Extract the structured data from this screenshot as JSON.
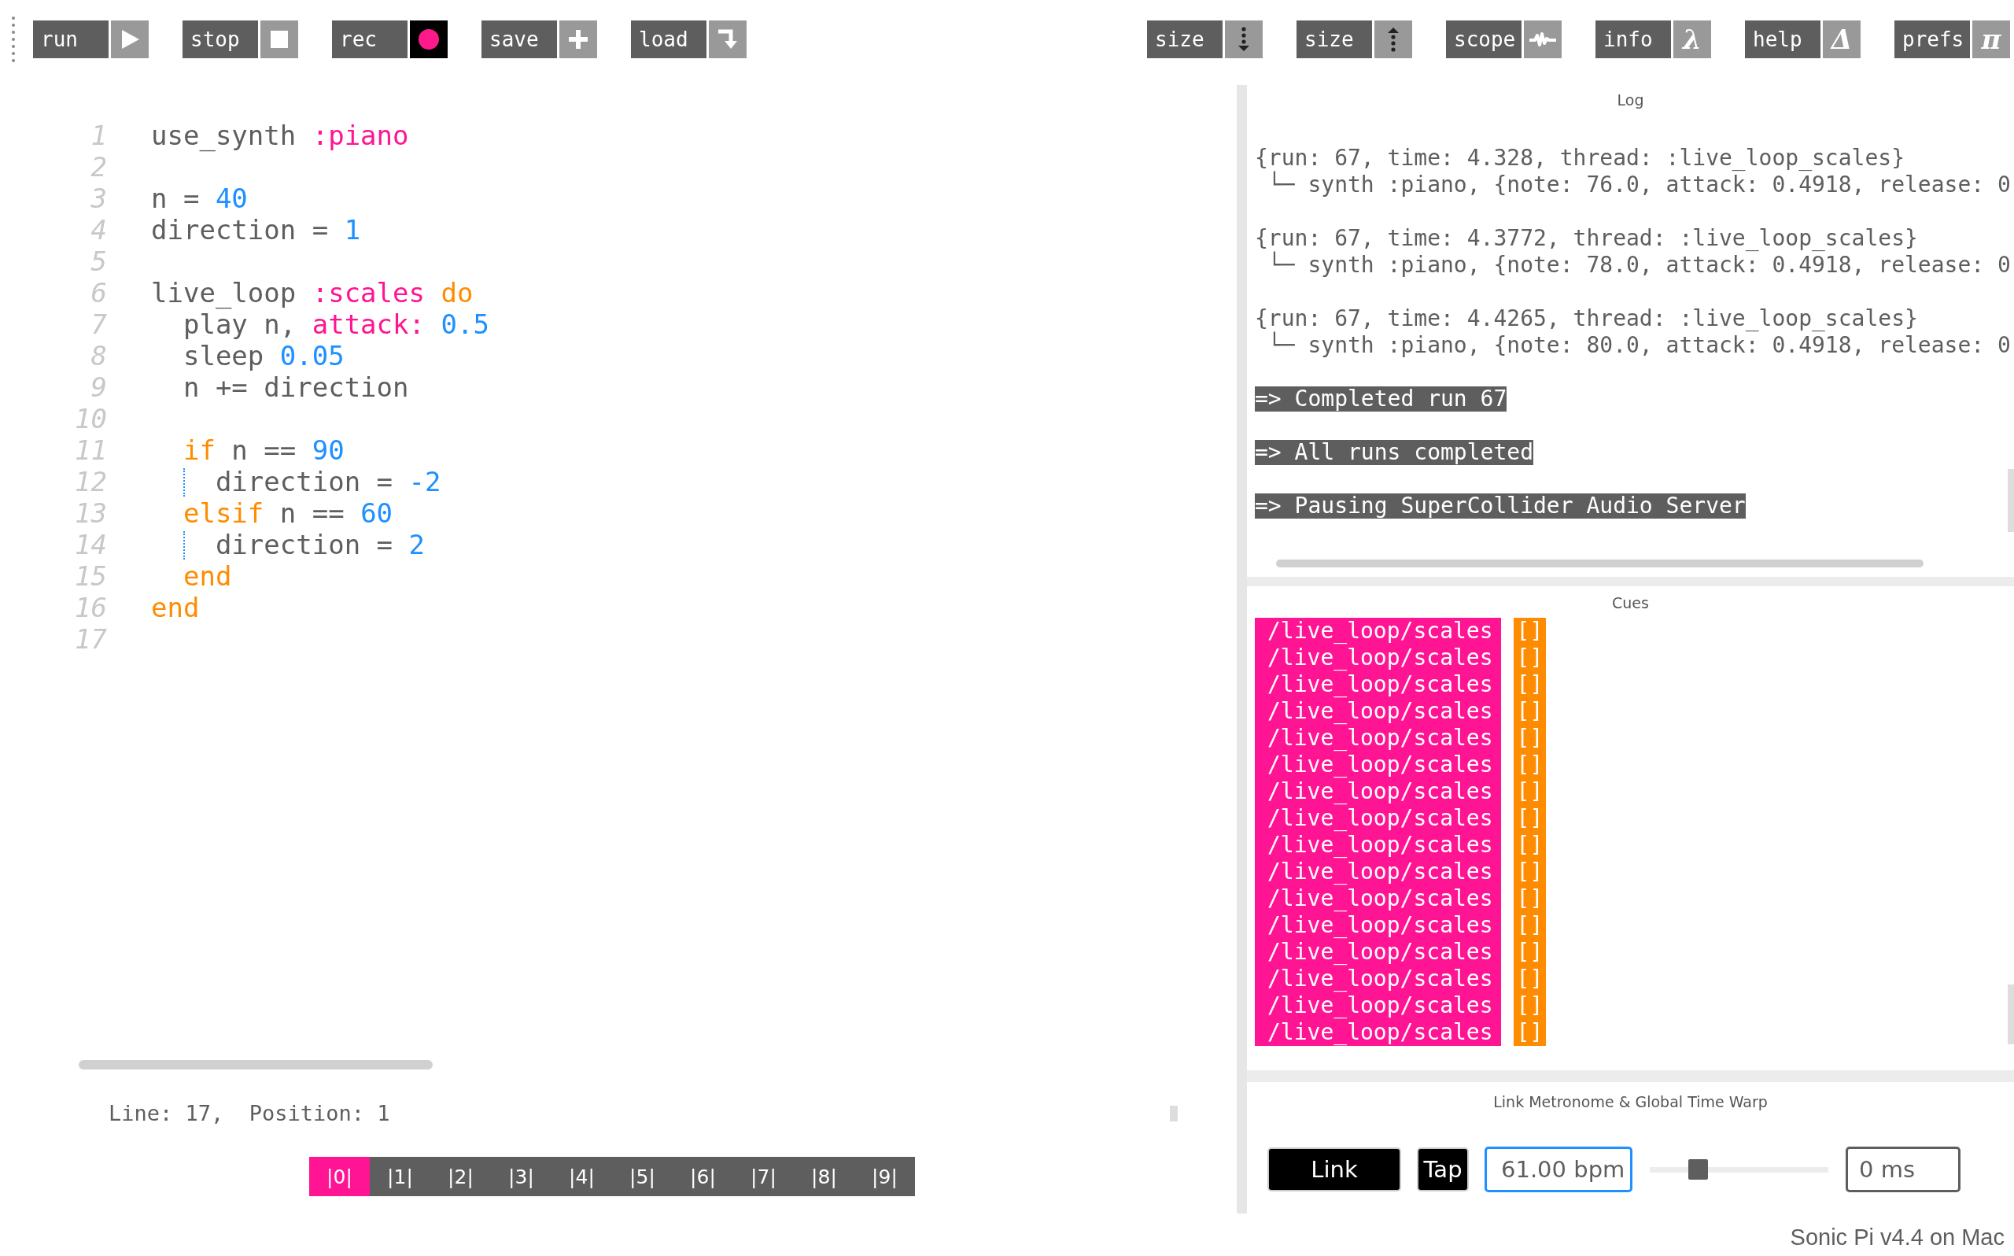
{
  "toolbar": {
    "left_buttons": [
      {
        "label": "run"
      },
      {
        "label": "stop"
      },
      {
        "label": "rec"
      },
      {
        "label": "save"
      },
      {
        "label": "load"
      }
    ],
    "right_buttons": [
      {
        "label": "size"
      },
      {
        "label": "size"
      },
      {
        "label": "scope"
      },
      {
        "label": "info",
        "glyph": "λ"
      },
      {
        "label": "help",
        "glyph": "Δ"
      },
      {
        "label": "prefs",
        "glyph": "π"
      }
    ]
  },
  "editor": {
    "lines": [
      {
        "number": "1",
        "tokens": [
          {
            "text": "use_synth ",
            "kind": "plain"
          },
          {
            "text": ":piano",
            "kind": "symbol"
          }
        ]
      },
      {
        "number": "2"
      },
      {
        "number": "3",
        "tokens": [
          {
            "text": "n = ",
            "kind": "plain"
          },
          {
            "text": "40",
            "kind": "number"
          }
        ]
      },
      {
        "number": "4",
        "tokens": [
          {
            "text": "direction = ",
            "kind": "plain"
          },
          {
            "text": "1",
            "kind": "number"
          }
        ]
      },
      {
        "number": "5"
      },
      {
        "number": "6",
        "tokens": [
          {
            "text": "live_loop ",
            "kind": "plain"
          },
          {
            "text": ":scales",
            "kind": "symbol"
          },
          {
            "text": " do",
            "kind": "keyword"
          }
        ]
      },
      {
        "number": "7",
        "tokens": [
          {
            "text": "  play n, ",
            "kind": "plain"
          },
          {
            "text": "attack:",
            "kind": "symbol"
          },
          {
            "text": " 0.5",
            "kind": "number"
          }
        ]
      },
      {
        "number": "8",
        "tokens": [
          {
            "text": "  sleep ",
            "kind": "plain"
          },
          {
            "text": "0.05",
            "kind": "number"
          }
        ]
      },
      {
        "number": "9",
        "tokens": [
          {
            "text": "  n += direction",
            "kind": "plain"
          }
        ]
      },
      {
        "number": "10"
      },
      {
        "number": "11",
        "tokens": [
          {
            "text": "  if",
            "kind": "keyword"
          },
          {
            "text": " n == ",
            "kind": "plain"
          },
          {
            "text": "90",
            "kind": "number"
          }
        ]
      },
      {
        "number": "12",
        "indent_guide": true,
        "tokens": [
          {
            "text": "    direction = ",
            "kind": "plain"
          },
          {
            "text": "-2",
            "kind": "number"
          }
        ]
      },
      {
        "number": "13",
        "tokens": [
          {
            "text": "  elsif",
            "kind": "keyword"
          },
          {
            "text": " n == ",
            "kind": "plain"
          },
          {
            "text": "60",
            "kind": "number"
          }
        ]
      },
      {
        "number": "14",
        "indent_guide": true,
        "tokens": [
          {
            "text": "    direction = ",
            "kind": "plain"
          },
          {
            "text": "2",
            "kind": "number"
          }
        ]
      },
      {
        "number": "15",
        "tokens": [
          {
            "text": "  end",
            "kind": "keyword"
          }
        ]
      },
      {
        "number": "16",
        "tokens": [
          {
            "text": "end",
            "kind": "keyword"
          }
        ]
      },
      {
        "number": "17"
      }
    ],
    "status": "Line: 17,  Position: 1"
  },
  "buffers": [
    {
      "label": "|0|",
      "selected": true
    },
    {
      "label": "|1|",
      "selected": false
    },
    {
      "label": "|2|",
      "selected": false
    },
    {
      "label": "|3|",
      "selected": false
    },
    {
      "label": "|4|",
      "selected": false
    },
    {
      "label": "|5|",
      "selected": false
    },
    {
      "label": "|6|",
      "selected": false
    },
    {
      "label": "|7|",
      "selected": false
    },
    {
      "label": "|8|",
      "selected": false
    },
    {
      "label": "|9|",
      "selected": false
    }
  ],
  "log": {
    "title": "Log",
    "entries": [
      {
        "kind": "event",
        "header": "{run: 67, time: 4.328, thread: :live_loop_scales}",
        "detail": " └─ synth :piano, {note: 76.0, attack: 0.4918, release: 0"
      },
      {
        "kind": "event",
        "header": "{run: 67, time: 4.3772, thread: :live_loop_scales}",
        "detail": " └─ synth :piano, {note: 78.0, attack: 0.4918, release: 0"
      },
      {
        "kind": "event",
        "header": "{run: 67, time: 4.4265, thread: :live_loop_scales}",
        "detail": " └─ synth :piano, {note: 80.0, attack: 0.4918, release: 0"
      },
      {
        "kind": "notice",
        "text": "=> Completed run 67"
      },
      {
        "kind": "notice",
        "text": "=> All runs completed"
      },
      {
        "kind": "notice",
        "text": "=> Pausing SuperCollider Audio Server"
      }
    ]
  },
  "cues": {
    "title": "Cues",
    "items": [
      {
        "path": "/live_loop/scales",
        "args": "[]"
      },
      {
        "path": "/live_loop/scales",
        "args": "[]"
      },
      {
        "path": "/live_loop/scales",
        "args": "[]"
      },
      {
        "path": "/live_loop/scales",
        "args": "[]"
      },
      {
        "path": "/live_loop/scales",
        "args": "[]"
      },
      {
        "path": "/live_loop/scales",
        "args": "[]"
      },
      {
        "path": "/live_loop/scales",
        "args": "[]"
      },
      {
        "path": "/live_loop/scales",
        "args": "[]"
      },
      {
        "path": "/live_loop/scales",
        "args": "[]"
      },
      {
        "path": "/live_loop/scales",
        "args": "[]"
      },
      {
        "path": "/live_loop/scales",
        "args": "[]"
      },
      {
        "path": "/live_loop/scales",
        "args": "[]"
      },
      {
        "path": "/live_loop/scales",
        "args": "[]"
      },
      {
        "path": "/live_loop/scales",
        "args": "[]"
      },
      {
        "path": "/live_loop/scales",
        "args": "[]"
      },
      {
        "path": "/live_loop/scales",
        "args": "[]"
      }
    ]
  },
  "metronome": {
    "title": "Link Metronome & Global Time Warp",
    "link_button": "Link",
    "tap_button": "Tap",
    "bpm": "61.00 bpm",
    "slider": {
      "level": 0.27
    },
    "time_warp": "0 ms"
  },
  "footer": "Sonic Pi v4.4 on Mac"
}
